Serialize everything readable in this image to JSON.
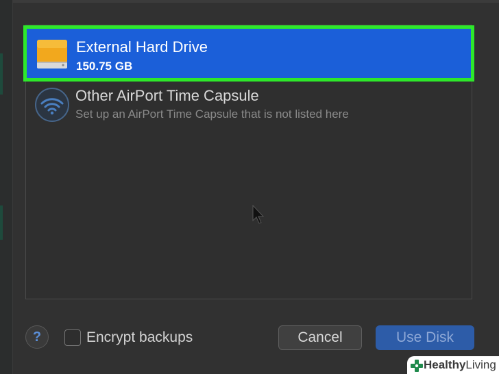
{
  "list": {
    "selected_item": {
      "title": "External Hard Drive",
      "subtitle": "150.75 GB",
      "icon": "external-drive-icon"
    },
    "other_item": {
      "title": "Other AirPort Time Capsule",
      "subtitle": "Set up an AirPort Time Capsule that is not listed here",
      "icon": "wifi-icon"
    }
  },
  "footer": {
    "help_label": "?",
    "encrypt_label": "Encrypt backups",
    "encrypt_checked": false,
    "cancel_label": "Cancel",
    "use_disk_label": "Use Disk"
  },
  "watermark": {
    "brand_bold": "Healthy",
    "brand_light": "Living"
  },
  "colors": {
    "selection": "#1b5fd9",
    "highlight_border": "#2ee82b",
    "primary_button": "#2d5ca8"
  }
}
